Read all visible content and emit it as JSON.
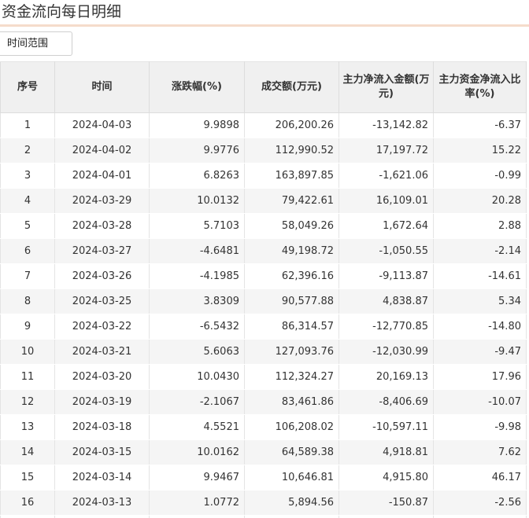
{
  "page_title": "资金流向每日明细",
  "range_button_label": "时间范围",
  "table": {
    "headers": [
      "序号",
      "时间",
      "涨跌幅(%)",
      "成交额(万元)",
      "主力净流入金额(万元)",
      "主力资金净流入比率(%)"
    ],
    "rows": [
      [
        "1",
        "2024-04-03",
        "9.9898",
        "206,200.26",
        "-13,142.82",
        "-6.37"
      ],
      [
        "2",
        "2024-04-02",
        "9.9776",
        "112,990.52",
        "17,197.72",
        "15.22"
      ],
      [
        "3",
        "2024-04-01",
        "6.8263",
        "163,897.85",
        "-1,621.06",
        "-0.99"
      ],
      [
        "4",
        "2024-03-29",
        "10.0132",
        "79,422.61",
        "16,109.01",
        "20.28"
      ],
      [
        "5",
        "2024-03-28",
        "5.7103",
        "58,049.26",
        "1,672.64",
        "2.88"
      ],
      [
        "6",
        "2024-03-27",
        "-4.6481",
        "49,198.72",
        "-1,050.55",
        "-2.14"
      ],
      [
        "7",
        "2024-03-26",
        "-4.1985",
        "62,396.16",
        "-9,113.87",
        "-14.61"
      ],
      [
        "8",
        "2024-03-25",
        "3.8309",
        "90,577.88",
        "4,838.87",
        "5.34"
      ],
      [
        "9",
        "2024-03-22",
        "-6.5432",
        "86,314.57",
        "-12,770.85",
        "-14.80"
      ],
      [
        "10",
        "2024-03-21",
        "5.6063",
        "127,093.76",
        "-12,030.99",
        "-9.47"
      ],
      [
        "11",
        "2024-03-20",
        "10.0430",
        "112,324.27",
        "20,169.13",
        "17.96"
      ],
      [
        "12",
        "2024-03-19",
        "-2.1067",
        "83,461.86",
        "-8,406.69",
        "-10.07"
      ],
      [
        "13",
        "2024-03-18",
        "4.5521",
        "106,208.02",
        "-10,597.11",
        "-9.98"
      ],
      [
        "14",
        "2024-03-15",
        "10.0162",
        "64,589.38",
        "4,918.81",
        "7.62"
      ],
      [
        "15",
        "2024-03-14",
        "9.9467",
        "10,646.81",
        "4,915.80",
        "46.17"
      ],
      [
        "16",
        "2024-03-13",
        "1.0772",
        "5,894.56",
        "-150.87",
        "-2.56"
      ],
      [
        "",
        "",
        "",
        "",
        "",
        ""
      ]
    ]
  },
  "colors": {
    "title_underline": "#f5dccb",
    "header_bg": "#f0f0f0",
    "row_alt_bg": "#f5f5f5"
  }
}
